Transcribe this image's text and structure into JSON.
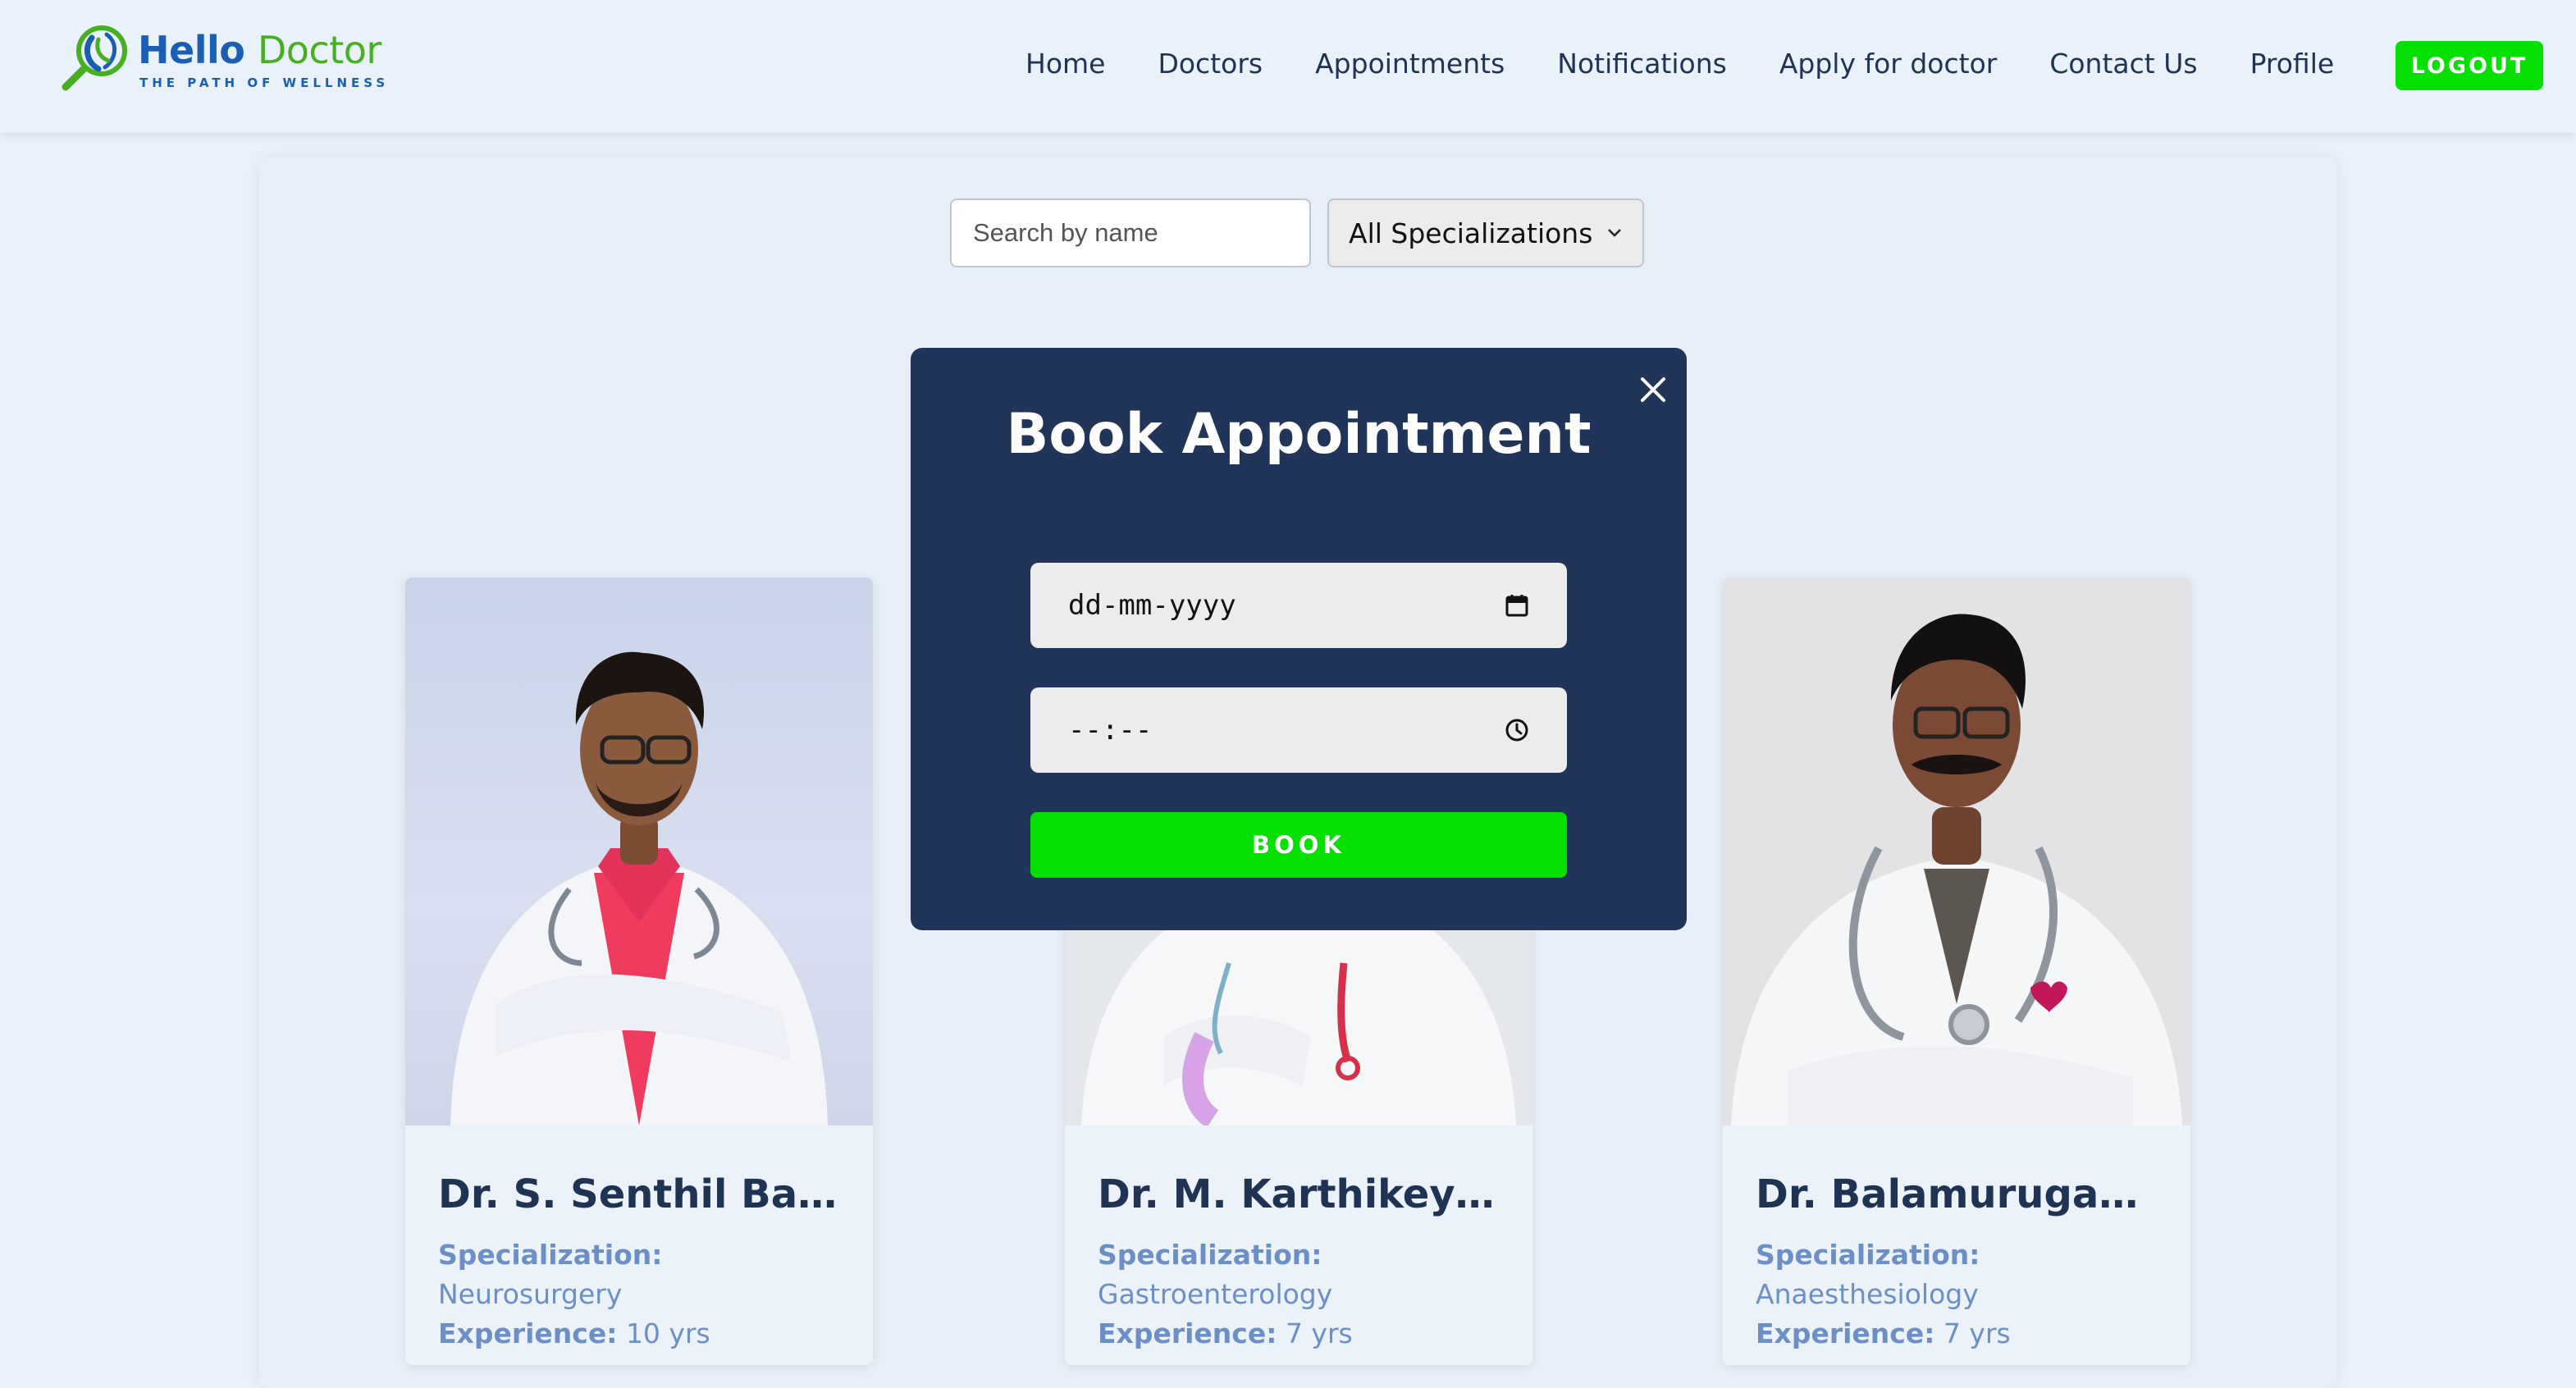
{
  "brand": {
    "name_part1": "Hello",
    "name_part2": "Doctor",
    "tagline": "THE PATH OF WELLNESS",
    "primary_color": "#1a5fb4",
    "accent_color": "#47b021"
  },
  "nav": {
    "items": [
      {
        "label": "Home"
      },
      {
        "label": "Doctors"
      },
      {
        "label": "Appointments"
      },
      {
        "label": "Notifications"
      },
      {
        "label": "Apply for doctor"
      },
      {
        "label": "Contact Us"
      },
      {
        "label": "Profile"
      }
    ],
    "logout_label": "LOGOUT",
    "logout_color": "#06e000"
  },
  "filters": {
    "search_placeholder": "Search by name",
    "specialization_selected": "All Specializations"
  },
  "modal": {
    "title": "Book Appointment",
    "date_placeholder": "dd-mm-yyyy",
    "time_placeholder": "--:--",
    "book_label": "BOOK",
    "background_color": "#203559"
  },
  "doctors": [
    {
      "name": "Dr. S. Senthil Babu",
      "specialization_label": "Specialization:",
      "specialization": "Neurosurgery",
      "experience_label": "Experience:",
      "experience": "10 yrs"
    },
    {
      "name": "Dr. M. Karthikeya...",
      "specialization_label": "Specialization:",
      "specialization": "Gastroenterology",
      "experience_label": "Experience:",
      "experience": "7 yrs"
    },
    {
      "name": "Dr. Balamurugan K",
      "specialization_label": "Specialization:",
      "specialization": "Anaesthesiology",
      "experience_label": "Experience:",
      "experience": "7 yrs"
    }
  ]
}
